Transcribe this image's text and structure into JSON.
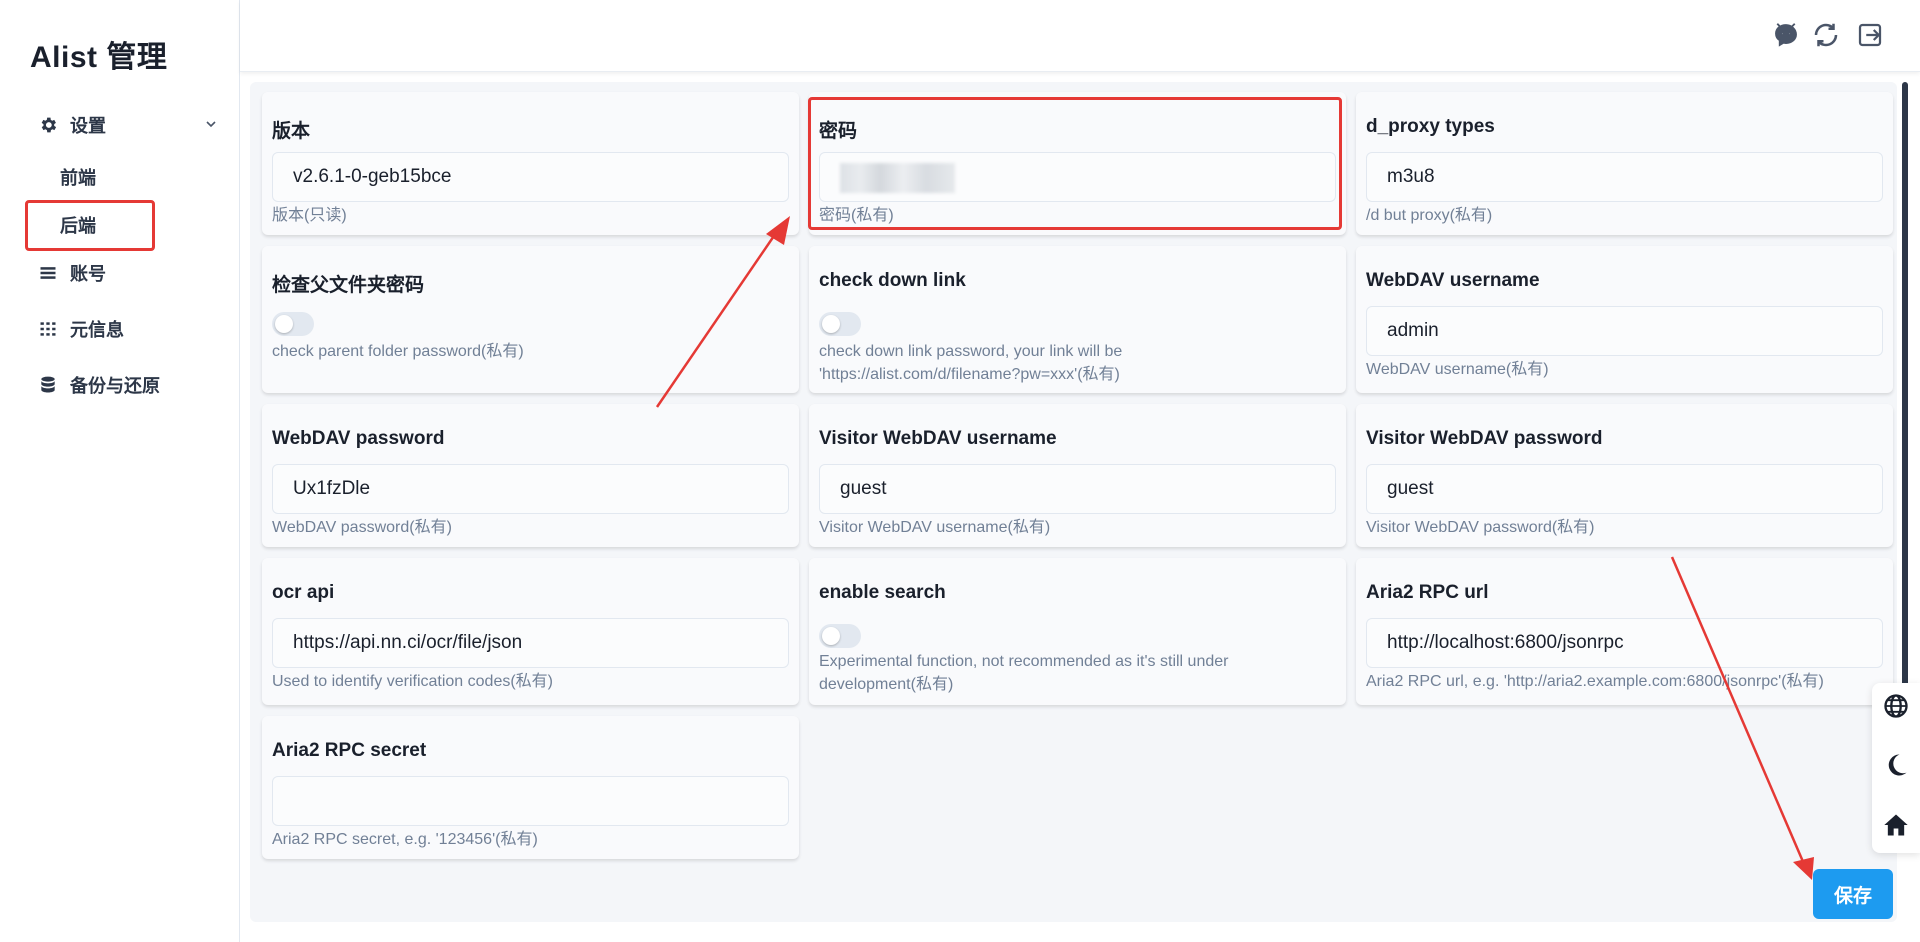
{
  "sidebar": {
    "brand": "Alist 管理",
    "settings_label": "设置",
    "sub_items": [
      "前端",
      "后端"
    ],
    "items": [
      "账号",
      "元信息",
      "备份与还原"
    ]
  },
  "cards": [
    {
      "label": "版本",
      "value": "v2.6.1-0-geb15bce",
      "help": "版本(只读)"
    },
    {
      "label": "密码",
      "value": "",
      "help": "密码(私有)"
    },
    {
      "label": "d_proxy types",
      "value": "m3u8",
      "help": "/d but proxy(私有)"
    },
    {
      "label": "检查父文件夹密码",
      "help": "check parent folder password(私有)"
    },
    {
      "label": "check down link",
      "help_line1": "check down link password, your link will be",
      "help_line2": "'https://alist.com/d/filename?pw=xxx'(私有)"
    },
    {
      "label": "WebDAV username",
      "value": "admin",
      "help": "WebDAV username(私有)"
    },
    {
      "label": "WebDAV password",
      "value": "Ux1fzDle",
      "help": "WebDAV password(私有)"
    },
    {
      "label": "Visitor WebDAV username",
      "value": "guest",
      "help": "Visitor WebDAV username(私有)"
    },
    {
      "label": "Visitor WebDAV password",
      "value": "guest",
      "help": "Visitor WebDAV password(私有)"
    },
    {
      "label": "ocr api",
      "value": "https://api.nn.ci/ocr/file/json",
      "help": "Used to identify verification codes(私有)"
    },
    {
      "label": "enable search",
      "help_line1": "Experimental function, not recommended as it's still under",
      "help_line2": "development(私有)"
    },
    {
      "label": "Aria2 RPC url",
      "value": "http://localhost:6800/jsonrpc",
      "help": "Aria2 RPC url, e.g. 'http://aria2.example.com:6800/jsonrpc'(私有)"
    },
    {
      "label": "Aria2 RPC secret",
      "value": "",
      "help": "Aria2 RPC secret, e.g. '123456'(私有)"
    }
  ],
  "toggles": {
    "check_parent_folder_password": false,
    "check_down_link": false,
    "enable_search": false
  },
  "header_icons": [
    "github-icon",
    "refresh-icon",
    "logout-icon"
  ],
  "float_icons": [
    "globe-icon",
    "moon-icon",
    "home-icon"
  ],
  "save_label": "保存",
  "colors": {
    "accent": "#1d9bf0",
    "annotation": "#e53935",
    "panel": "#f4f6f9"
  }
}
